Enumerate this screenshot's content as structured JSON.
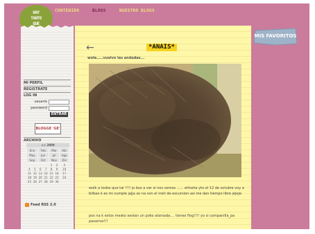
{
  "logo": {
    "line1": "HAY",
    "line2": "TANTO",
    "line3": "QUE"
  },
  "nav": {
    "items": [
      {
        "label": "CONTENIDO"
      },
      {
        "label": "BLOGS"
      },
      {
        "label": "NUESTRO BLOGS"
      }
    ]
  },
  "sidebar": {
    "mi_perfil": "MI PERFIL",
    "registrate": "REGISTRATE",
    "login_title": "LOG IN",
    "user_label": "usuario",
    "password_label": "password",
    "enter_label": "ENTRAR",
    "badge_text": "BLOGGE 'GE'",
    "archivo": "ARCHIVO",
    "calendar": {
      "year_label": "<< 2009",
      "months": [
        [
          "Ene",
          "Feb",
          "Mar",
          "Abr"
        ],
        [
          "May",
          "Jun",
          "Jul",
          "Ago"
        ],
        [
          "Sep",
          "Oct",
          "Nov",
          "Dic"
        ]
      ],
      "days": [
        [
          "",
          "",
          "",
          "",
          "1",
          "2",
          "3"
        ],
        [
          "4",
          "5",
          "6",
          "7",
          "8",
          "9",
          "10"
        ],
        [
          "11",
          "12",
          "13",
          "14",
          "15",
          "16",
          "17"
        ],
        [
          "18",
          "19",
          "20",
          "21",
          "22",
          "23",
          "24"
        ],
        [
          "25",
          "26",
          "27",
          "28",
          "29",
          "30",
          ""
        ]
      ]
    },
    "rss": "Feed RSS 2.0"
  },
  "post": {
    "title": "*ANAIS*",
    "subtitle": "wola.....vuelvo las andadas...",
    "para1": "wolk a todos que tal !!!! jo bos a ver si nos vemos ...... ehhehe yto el 12 de octubre voy a bilbao k es mi cumple jajja xo na con el insti de excursion asi me dan tiempo libre jejeje",
    "para2": "pos na k estos mesko sestan un poko atarsada.... tienes flog!!!! yo si campanilla_pa pasarros!!!"
  },
  "favorites": {
    "label": "MIS FAVORITOS"
  },
  "colors": {
    "background": "#cb7c9d",
    "note_yellow": "#fff7a8",
    "title_highlight": "#f5d21e",
    "nav_yellow": "#f0e27a",
    "logo_green": "#8aa23a"
  }
}
